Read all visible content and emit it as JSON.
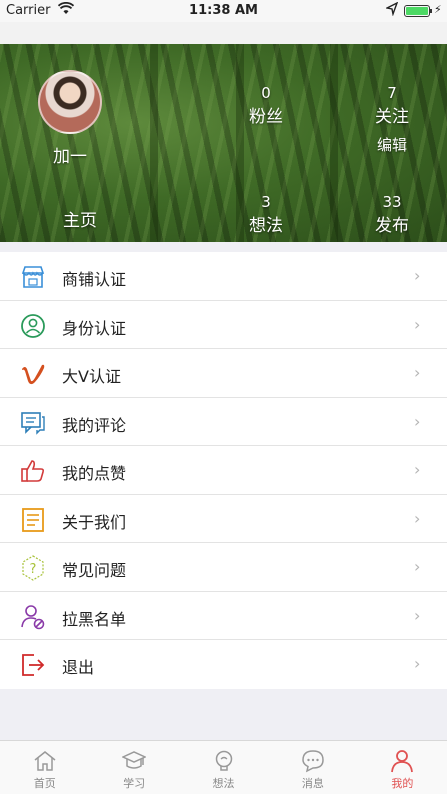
{
  "status_bar": {
    "carrier": "Carrier",
    "time": "11:38 AM",
    "battery_level": 1.0
  },
  "profile": {
    "name": "加一",
    "fans": {
      "value": "0",
      "label": "粉丝"
    },
    "follow": {
      "value": "7",
      "label": "关注"
    },
    "edit_label": "编辑",
    "home_label": "主页",
    "ideas": {
      "value": "3",
      "label": "想法"
    },
    "posts": {
      "value": "33",
      "label": "发布"
    }
  },
  "menu": {
    "items": [
      {
        "label": "商铺认证",
        "icon": "shop-icon",
        "color": "#3a8fd8"
      },
      {
        "label": "身份认证",
        "icon": "user-circle-icon",
        "color": "#2a9a5a"
      },
      {
        "label": "大V认证",
        "icon": "vimeo-v-icon",
        "color": "#d4501f"
      },
      {
        "label": "我的评论",
        "icon": "comment-icon",
        "color": "#2e7fb8"
      },
      {
        "label": "我的点赞",
        "icon": "thumbs-up-icon",
        "color": "#d23a3a"
      },
      {
        "label": "关于我们",
        "icon": "document-icon",
        "color": "#e89a1a"
      },
      {
        "label": "常见问题",
        "icon": "question-hexagon-icon",
        "color": "#a8c23a"
      },
      {
        "label": "拉黑名单",
        "icon": "user-block-icon",
        "color": "#8a3aa8"
      },
      {
        "label": "退出",
        "icon": "logout-icon",
        "color": "#d02a2a"
      }
    ],
    "chevron": "›"
  },
  "tabs": [
    {
      "label": "首页",
      "icon": "home-icon"
    },
    {
      "label": "学习",
      "icon": "graduation-cap-icon"
    },
    {
      "label": "想法",
      "icon": "lightbulb-icon"
    },
    {
      "label": "消息",
      "icon": "chat-bubble-icon"
    },
    {
      "label": "我的",
      "icon": "person-icon",
      "active": true
    }
  ],
  "colors": {
    "accent": "#e05252",
    "tab_inactive": "#888888"
  }
}
